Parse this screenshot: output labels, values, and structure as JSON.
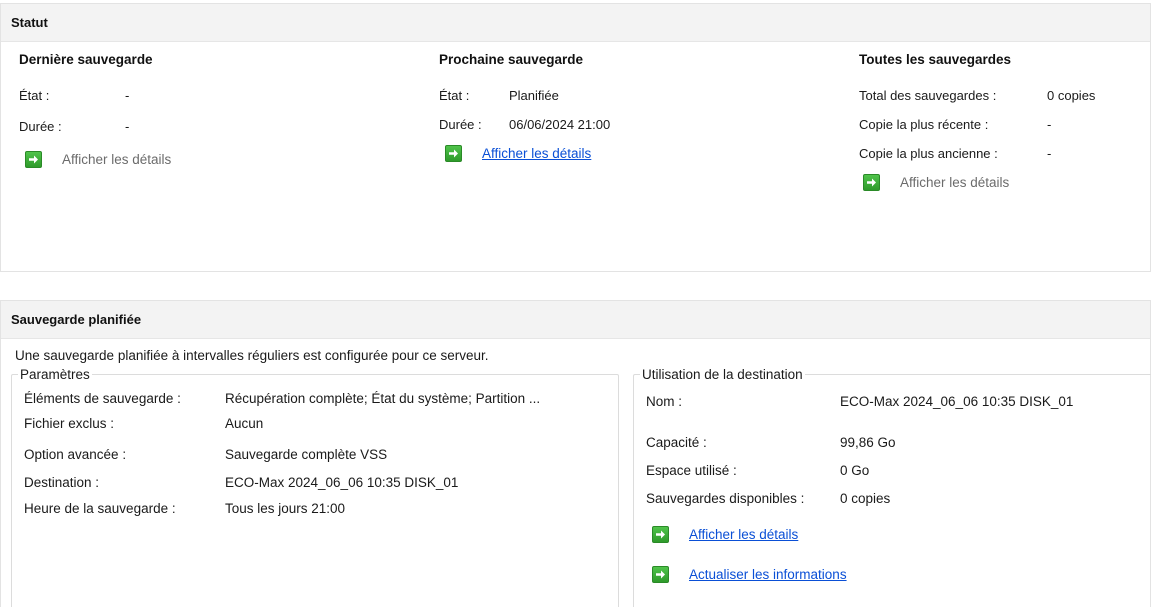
{
  "statut": {
    "title": "Statut",
    "last_backup": {
      "title": "Dernière sauvegarde",
      "state_label": "État :",
      "state_value": "-",
      "duration_label": "Durée :",
      "duration_value": "-",
      "details_link": "Afficher les détails"
    },
    "next_backup": {
      "title": "Prochaine sauvegarde",
      "state_label": "État :",
      "state_value": "Planifiée",
      "duration_label": "Durée :",
      "duration_value": "06/06/2024 21:00",
      "details_link": "Afficher les détails"
    },
    "all_backups": {
      "title": "Toutes les sauvegardes",
      "total_label": "Total des sauvegardes :",
      "total_value": "0 copies",
      "latest_label": "Copie la plus récente :",
      "latest_value": "-",
      "oldest_label": "Copie la plus ancienne :",
      "oldest_value": "-",
      "details_link": "Afficher les détails"
    }
  },
  "scheduled": {
    "title": "Sauvegarde planifiée",
    "intro": "Une sauvegarde planifiée à intervalles réguliers est configurée pour ce serveur.",
    "params": {
      "legend": "Paramètres",
      "rows": [
        {
          "label": "Éléments de sauvegarde :",
          "value": "Récupération complète; État du système; Partition ..."
        },
        {
          "label": "Fichier exclus :",
          "value": "Aucun"
        },
        {
          "label": "Option avancée :",
          "value": "Sauvegarde complète VSS"
        },
        {
          "label": "Destination :",
          "value": "ECO-Max 2024_06_06 10:35 DISK_01"
        },
        {
          "label": "Heure de la sauvegarde :",
          "value": "Tous les jours 21:00"
        }
      ]
    },
    "destination": {
      "legend": "Utilisation de la destination",
      "name_label": "Nom :",
      "name_value": "ECO-Max 2024_06_06 10:35 DISK_01",
      "capacity_label": "Capacité :",
      "capacity_value": "99,86 Go",
      "used_label": "Espace utilisé :",
      "used_value": "0 Go",
      "available_label": "Sauvegardes disponibles :",
      "available_value": "0 copies",
      "details_link": "Afficher les détails",
      "refresh_link": "Actualiser les informations"
    }
  },
  "colors": {
    "link": "#0a4fd6",
    "disabled_link": "#6b6b6b",
    "icon_green": "#3aaf36",
    "header_bg": "#f3f3f3"
  }
}
